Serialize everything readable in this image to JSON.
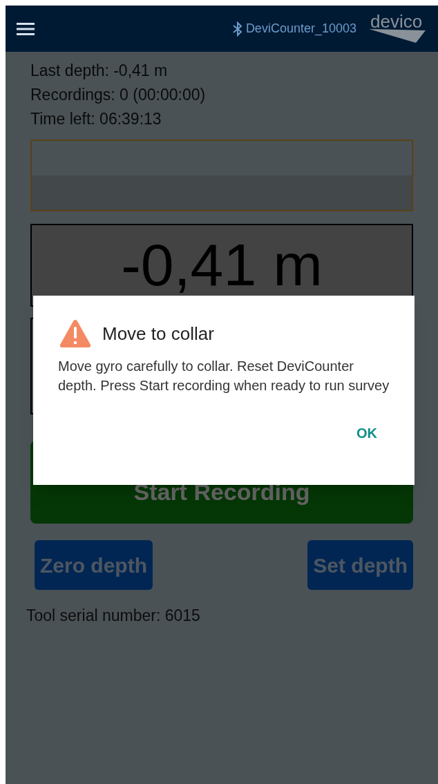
{
  "header": {
    "device": "DeviCounter_10003",
    "logo": "devico"
  },
  "status_lines": [
    "Last depth: -0,41 m",
    "Recordings: 0 (00:00:00)",
    "Time left: 06:39:13"
  ],
  "depth_display": "-0,41 m",
  "start_button": "Start Recording",
  "buttons": [
    "Zero depth",
    "Set depth"
  ],
  "serial": "Tool serial number: 6015",
  "dialog": {
    "title": "Move to collar",
    "message": "Move gyro carefully to collar. Reset DeviCounter depth. Press Start recording when ready to run survey",
    "ok": "OK"
  }
}
